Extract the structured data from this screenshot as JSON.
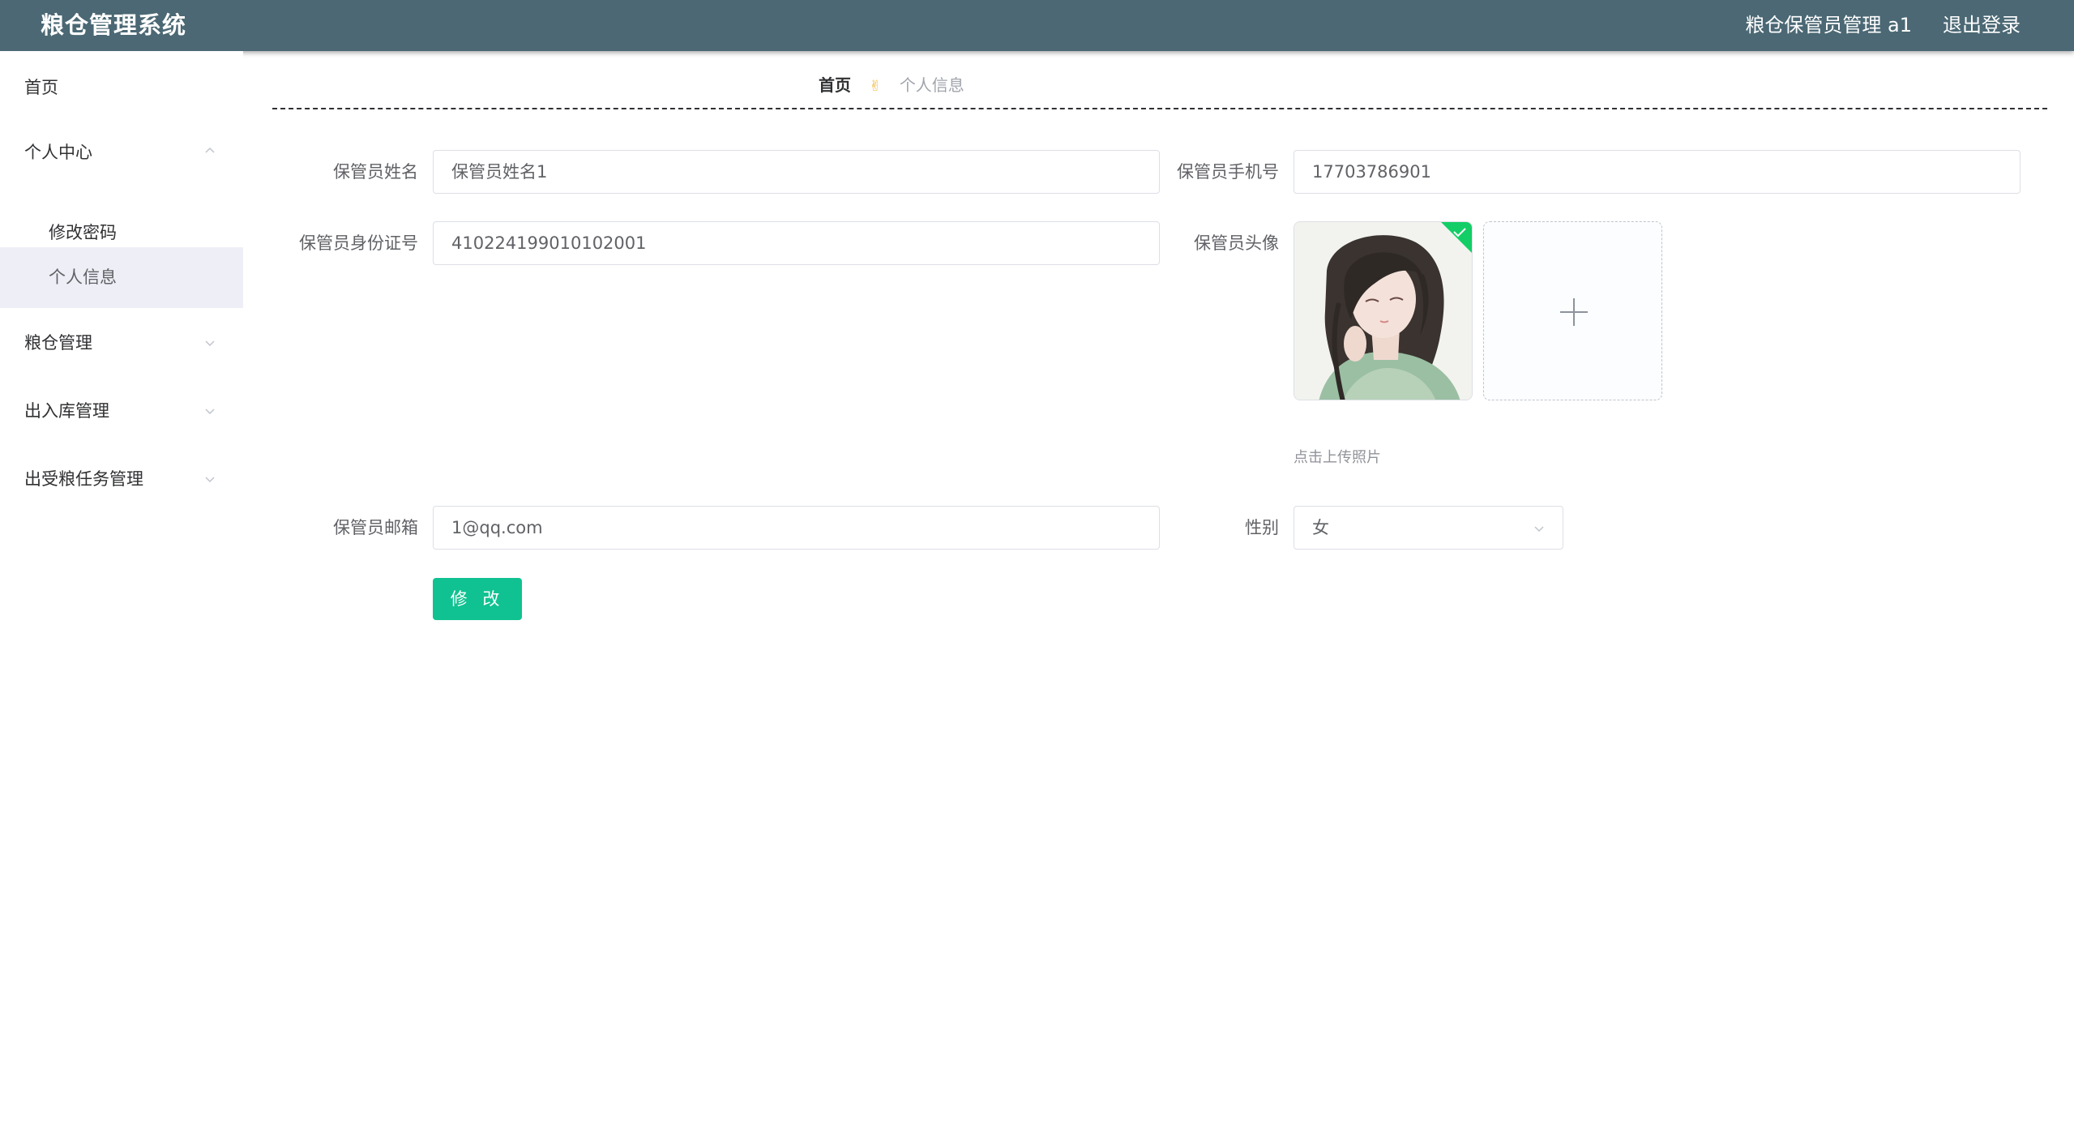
{
  "header": {
    "app_title": "粮仓管理系统",
    "user_info": "粮仓保管员管理 a1",
    "logout_label": "退出登录",
    "background_color": "#4b6874"
  },
  "sidebar": {
    "home_label": "首页",
    "personal_center": {
      "label": "个人中心",
      "expanded": true,
      "children": [
        {
          "label": "修改密码",
          "active": false
        },
        {
          "label": "个人信息",
          "active": true
        }
      ]
    },
    "granary_management": {
      "label": "粮仓管理",
      "expanded": false
    },
    "inout_management": {
      "label": "出入库管理",
      "expanded": false
    },
    "task_management": {
      "label": "出受粮任务管理",
      "expanded": false
    }
  },
  "breadcrumb": {
    "home": "首页",
    "separator_icon": "victory-hand-icon",
    "current": "个人信息"
  },
  "form": {
    "name": {
      "label": "保管员姓名",
      "value": "保管员姓名1"
    },
    "phone": {
      "label": "保管员手机号",
      "value": "17703786901"
    },
    "id_card": {
      "label": "保管员身份证号",
      "value": "410224199010102001"
    },
    "avatar": {
      "label": "保管员头像",
      "upload_tip": "点击上传照片"
    },
    "email": {
      "label": "保管员邮箱",
      "value": "1@qq.com"
    },
    "gender": {
      "label": "性别",
      "value": "女"
    },
    "submit_label": "修 改",
    "submit_color": "#10c291"
  }
}
